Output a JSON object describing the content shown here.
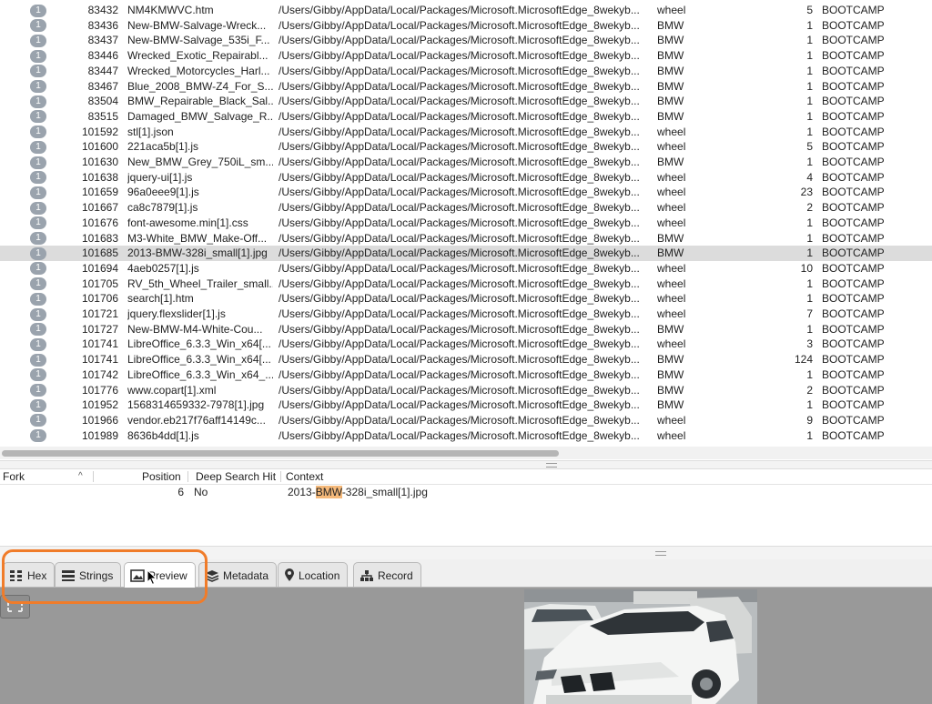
{
  "results": {
    "rows": [
      {
        "badge": "1",
        "id": "83432",
        "name": "NM4KMWVC.htm",
        "path": "/Users/Gibby/AppData/Local/Packages/Microsoft.MicrosoftEdge_8wekyb...",
        "term": "wheel",
        "hits": "5",
        "case": "BOOTCAMP"
      },
      {
        "badge": "1",
        "id": "83436",
        "name": "New-BMW-Salvage-Wreck...",
        "path": "/Users/Gibby/AppData/Local/Packages/Microsoft.MicrosoftEdge_8wekyb...",
        "term": "BMW",
        "hits": "1",
        "case": "BOOTCAMP"
      },
      {
        "badge": "1",
        "id": "83437",
        "name": "New-BMW-Salvage_535i_F...",
        "path": "/Users/Gibby/AppData/Local/Packages/Microsoft.MicrosoftEdge_8wekyb...",
        "term": "BMW",
        "hits": "1",
        "case": "BOOTCAMP"
      },
      {
        "badge": "1",
        "id": "83446",
        "name": "Wrecked_Exotic_Repairabl...",
        "path": "/Users/Gibby/AppData/Local/Packages/Microsoft.MicrosoftEdge_8wekyb...",
        "term": "BMW",
        "hits": "1",
        "case": "BOOTCAMP"
      },
      {
        "badge": "1",
        "id": "83447",
        "name": "Wrecked_Motorcycles_Harl...",
        "path": "/Users/Gibby/AppData/Local/Packages/Microsoft.MicrosoftEdge_8wekyb...",
        "term": "BMW",
        "hits": "1",
        "case": "BOOTCAMP"
      },
      {
        "badge": "1",
        "id": "83467",
        "name": "Blue_2008_BMW-Z4_For_S...",
        "path": "/Users/Gibby/AppData/Local/Packages/Microsoft.MicrosoftEdge_8wekyb...",
        "term": "BMW",
        "hits": "1",
        "case": "BOOTCAMP"
      },
      {
        "badge": "1",
        "id": "83504",
        "name": "BMW_Repairable_Black_Sal...",
        "path": "/Users/Gibby/AppData/Local/Packages/Microsoft.MicrosoftEdge_8wekyb...",
        "term": "BMW",
        "hits": "1",
        "case": "BOOTCAMP"
      },
      {
        "badge": "1",
        "id": "83515",
        "name": "Damaged_BMW_Salvage_R...",
        "path": "/Users/Gibby/AppData/Local/Packages/Microsoft.MicrosoftEdge_8wekyb...",
        "term": "BMW",
        "hits": "1",
        "case": "BOOTCAMP"
      },
      {
        "badge": "1",
        "id": "101592",
        "name": "stl[1].json",
        "path": "/Users/Gibby/AppData/Local/Packages/Microsoft.MicrosoftEdge_8wekyb...",
        "term": "wheel",
        "hits": "1",
        "case": "BOOTCAMP"
      },
      {
        "badge": "1",
        "id": "101600",
        "name": "221aca5b[1].js",
        "path": "/Users/Gibby/AppData/Local/Packages/Microsoft.MicrosoftEdge_8wekyb...",
        "term": "wheel",
        "hits": "5",
        "case": "BOOTCAMP"
      },
      {
        "badge": "1",
        "id": "101630",
        "name": "New_BMW_Grey_750iL_sm...",
        "path": "/Users/Gibby/AppData/Local/Packages/Microsoft.MicrosoftEdge_8wekyb...",
        "term": "BMW",
        "hits": "1",
        "case": "BOOTCAMP"
      },
      {
        "badge": "1",
        "id": "101638",
        "name": "jquery-ui[1].js",
        "path": "/Users/Gibby/AppData/Local/Packages/Microsoft.MicrosoftEdge_8wekyb...",
        "term": "wheel",
        "hits": "4",
        "case": "BOOTCAMP"
      },
      {
        "badge": "1",
        "id": "101659",
        "name": "96a0eee9[1].js",
        "path": "/Users/Gibby/AppData/Local/Packages/Microsoft.MicrosoftEdge_8wekyb...",
        "term": "wheel",
        "hits": "23",
        "case": "BOOTCAMP"
      },
      {
        "badge": "1",
        "id": "101667",
        "name": "ca8c7879[1].js",
        "path": "/Users/Gibby/AppData/Local/Packages/Microsoft.MicrosoftEdge_8wekyb...",
        "term": "wheel",
        "hits": "2",
        "case": "BOOTCAMP"
      },
      {
        "badge": "1",
        "id": "101676",
        "name": "font-awesome.min[1].css",
        "path": "/Users/Gibby/AppData/Local/Packages/Microsoft.MicrosoftEdge_8wekyb...",
        "term": "wheel",
        "hits": "1",
        "case": "BOOTCAMP"
      },
      {
        "badge": "1",
        "id": "101683",
        "name": "M3-White_BMW_Make-Off...",
        "path": "/Users/Gibby/AppData/Local/Packages/Microsoft.MicrosoftEdge_8wekyb...",
        "term": "BMW",
        "hits": "1",
        "case": "BOOTCAMP"
      },
      {
        "badge": "1",
        "id": "101685",
        "name": "2013-BMW-328i_small[1].jpg",
        "path": "/Users/Gibby/AppData/Local/Packages/Microsoft.MicrosoftEdge_8wekyb...",
        "term": "BMW",
        "hits": "1",
        "case": "BOOTCAMP",
        "selected": true
      },
      {
        "badge": "1",
        "id": "101694",
        "name": "4aeb0257[1].js",
        "path": "/Users/Gibby/AppData/Local/Packages/Microsoft.MicrosoftEdge_8wekyb...",
        "term": "wheel",
        "hits": "10",
        "case": "BOOTCAMP"
      },
      {
        "badge": "1",
        "id": "101705",
        "name": "RV_5th_Wheel_Trailer_small...",
        "path": "/Users/Gibby/AppData/Local/Packages/Microsoft.MicrosoftEdge_8wekyb...",
        "term": "wheel",
        "hits": "1",
        "case": "BOOTCAMP"
      },
      {
        "badge": "1",
        "id": "101706",
        "name": "search[1].htm",
        "path": "/Users/Gibby/AppData/Local/Packages/Microsoft.MicrosoftEdge_8wekyb...",
        "term": "wheel",
        "hits": "1",
        "case": "BOOTCAMP"
      },
      {
        "badge": "1",
        "id": "101721",
        "name": "jquery.flexslider[1].js",
        "path": "/Users/Gibby/AppData/Local/Packages/Microsoft.MicrosoftEdge_8wekyb...",
        "term": "wheel",
        "hits": "7",
        "case": "BOOTCAMP"
      },
      {
        "badge": "1",
        "id": "101727",
        "name": "New-BMW-M4-White-Cou...",
        "path": "/Users/Gibby/AppData/Local/Packages/Microsoft.MicrosoftEdge_8wekyb...",
        "term": "BMW",
        "hits": "1",
        "case": "BOOTCAMP"
      },
      {
        "badge": "1",
        "id": "101741",
        "name": "LibreOffice_6.3.3_Win_x64[...",
        "path": "/Users/Gibby/AppData/Local/Packages/Microsoft.MicrosoftEdge_8wekyb...",
        "term": "wheel",
        "hits": "3",
        "case": "BOOTCAMP"
      },
      {
        "badge": "1",
        "id": "101741",
        "name": "LibreOffice_6.3.3_Win_x64[...",
        "path": "/Users/Gibby/AppData/Local/Packages/Microsoft.MicrosoftEdge_8wekyb...",
        "term": "BMW",
        "hits": "124",
        "case": "BOOTCAMP"
      },
      {
        "badge": "1",
        "id": "101742",
        "name": "LibreOffice_6.3.3_Win_x64_...",
        "path": "/Users/Gibby/AppData/Local/Packages/Microsoft.MicrosoftEdge_8wekyb...",
        "term": "BMW",
        "hits": "1",
        "case": "BOOTCAMP"
      },
      {
        "badge": "1",
        "id": "101776",
        "name": "www.copart[1].xml",
        "path": "/Users/Gibby/AppData/Local/Packages/Microsoft.MicrosoftEdge_8wekyb...",
        "term": "BMW",
        "hits": "2",
        "case": "BOOTCAMP"
      },
      {
        "badge": "1",
        "id": "101952",
        "name": "1568314659332-7978[1].jpg",
        "path": "/Users/Gibby/AppData/Local/Packages/Microsoft.MicrosoftEdge_8wekyb...",
        "term": "BMW",
        "hits": "1",
        "case": "BOOTCAMP"
      },
      {
        "badge": "1",
        "id": "101966",
        "name": "vendor.eb217f76aff14149c...",
        "path": "/Users/Gibby/AppData/Local/Packages/Microsoft.MicrosoftEdge_8wekyb...",
        "term": "wheel",
        "hits": "9",
        "case": "BOOTCAMP"
      },
      {
        "badge": "1",
        "id": "101989",
        "name": "8636b4dd[1].js",
        "path": "/Users/Gibby/AppData/Local/Packages/Microsoft.MicrosoftEdge_8wekyb...",
        "term": "wheel",
        "hits": "1",
        "case": "BOOTCAMP"
      }
    ]
  },
  "hits_table": {
    "headers": {
      "fork": "Fork",
      "position": "Position",
      "deep_search": "Deep Search Hit",
      "context": "Context"
    },
    "row": {
      "position": "6",
      "deep_search": "No",
      "context_pre": "2013-",
      "context_match": "BMW",
      "context_post": "-328i_small[1].jpg"
    }
  },
  "tabs": [
    {
      "label": "Hex",
      "icon": "hex-grid-icon"
    },
    {
      "label": "Strings",
      "icon": "strings-list-icon"
    },
    {
      "label": "Preview",
      "icon": "image-icon",
      "active": true
    },
    {
      "label": "Metadata",
      "icon": "layers-icon"
    },
    {
      "label": "Location",
      "icon": "map-pin-icon"
    },
    {
      "label": "Record",
      "icon": "sitemap-icon"
    }
  ],
  "colors": {
    "highlight_box": "#f07c2a",
    "match_highlight": "#f5b97a",
    "badge": "#9aa3ad"
  }
}
